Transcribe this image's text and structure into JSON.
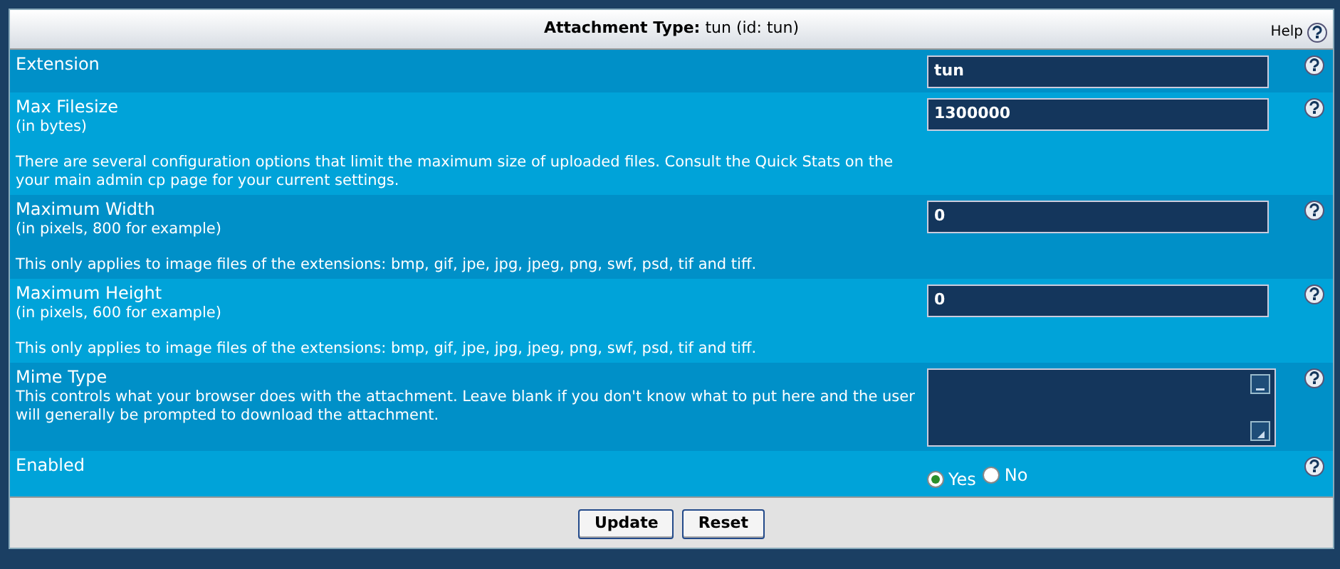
{
  "header": {
    "title": "**Attachment Type:** tun (id: tun)",
    "help": "Help"
  },
  "rows": [
    {
      "kind": "text",
      "label": "Extension",
      "value": "tun"
    },
    {
      "kind": "text",
      "label": "Max Filesize",
      "sublabel": "(in bytes)",
      "note": "There are several configuration options that limit the maximum size of uploaded files. Consult the Quick Stats on the your main admin cp page for your current settings.",
      "value": "1300000"
    },
    {
      "kind": "text",
      "label": "Maximum Width",
      "sublabel": "(in pixels, 800 for example)",
      "note": "This only applies to image files of the extensions: bmp, gif, jpe, jpg, jpeg, png, swf, psd, tif and tiff.",
      "value": "0"
    },
    {
      "kind": "text",
      "label": "Maximum Height",
      "sublabel": "(in pixels, 600 for example)",
      "note": "This only applies to image files of the extensions: bmp, gif, jpe, jpg, jpeg, png, swf, psd, tif and tiff.",
      "value": "0"
    },
    {
      "kind": "textarea",
      "label": "Mime Type",
      "sublabel": "This controls what your browser does with the attachment. Leave blank if you don't know what to put here and the user will generally be prompted to download the attachment."
    },
    {
      "kind": "radio",
      "label": "Enabled",
      "options": [
        {
          "label": "Yes",
          "selected": true
        },
        {
          "label": "No",
          "selected": false
        }
      ]
    }
  ],
  "buttons": [
    "Update",
    "Reset"
  ]
}
